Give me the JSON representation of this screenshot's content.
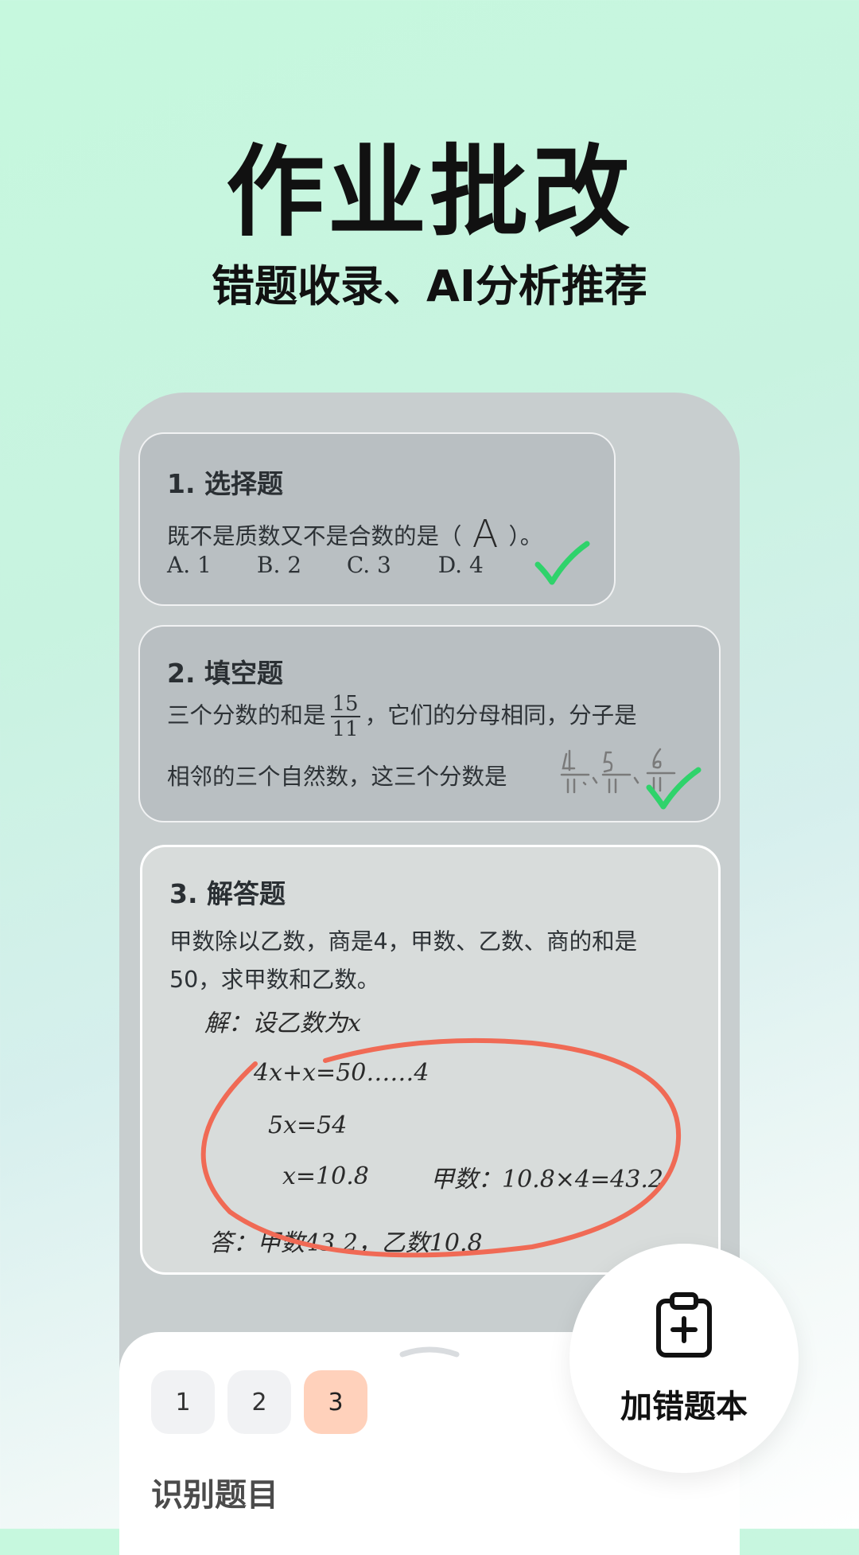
{
  "hero": {
    "title": "作业批改",
    "subtitle": "错题收录、AI分析推荐"
  },
  "questions": [
    {
      "title": "1. 选择题",
      "text_before": "既不是质数又不是合数的是（",
      "handwritten_answer": "A",
      "text_after": "）。",
      "options": [
        "A. 1",
        "B. 2",
        "C. 3",
        "D. 4"
      ],
      "result": "correct"
    },
    {
      "title": "2. 填空题",
      "text_line1_before": "三个分数的和是",
      "fraction_num": "15",
      "fraction_den": "11",
      "text_line1_after": "，它们的分母相同，分子是",
      "text_line2": "相邻的三个自然数，这三个分数是",
      "handwritten_answer": "4/11, 5/11, 6/11",
      "result": "correct"
    },
    {
      "title": "3. 解答题",
      "text_line1": "甲数除以乙数，商是4，甲数、乙数、商的和是",
      "text_line2": "50，求甲数和乙数。",
      "solution_lines": [
        "解：设乙数为x",
        "4x+x=50……4",
        "5x=54",
        "x=10.8",
        "甲数：10.8×4=43.2",
        "答：甲数43.2，乙数10.8"
      ],
      "result": "marked"
    }
  ],
  "pagination": {
    "pages": [
      "1",
      "2",
      "3"
    ],
    "active": "3"
  },
  "section": {
    "label": "识别题目"
  },
  "fab": {
    "label": "加错题本",
    "icon": "clipboard-plus-icon"
  },
  "colors": {
    "check": "#2fd36b",
    "circle": "#f06a55",
    "active_page": "#ffd1bb"
  }
}
